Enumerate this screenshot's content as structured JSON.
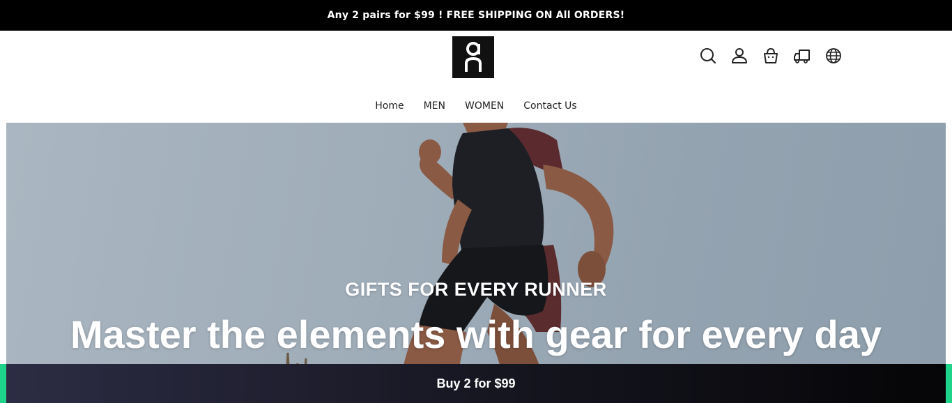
{
  "announcement": {
    "text": "Any 2 pairs for $99 ! FREE SHIPPING ON All ORDERS!"
  },
  "header": {
    "logo_text": "On",
    "icons": [
      {
        "name": "search-icon"
      },
      {
        "name": "account-icon"
      },
      {
        "name": "cart-icon"
      },
      {
        "name": "delivery-truck-icon"
      },
      {
        "name": "globe-icon"
      }
    ]
  },
  "nav": {
    "items": [
      {
        "label": "Home"
      },
      {
        "label": "MEN"
      },
      {
        "label": "WOMEN"
      },
      {
        "label": "Contact Us"
      }
    ]
  },
  "hero": {
    "eyebrow": "GIFTS FOR EVERY RUNNER",
    "title": "Master the elements with gear for every day"
  },
  "buy_bar": {
    "label": "Buy 2 for $99"
  },
  "colors": {
    "announcement_bg": "#000000",
    "accent_green": "#1ed38a",
    "hero_sky": "#9fadb9",
    "buy_bar_dark": "#15151f"
  }
}
